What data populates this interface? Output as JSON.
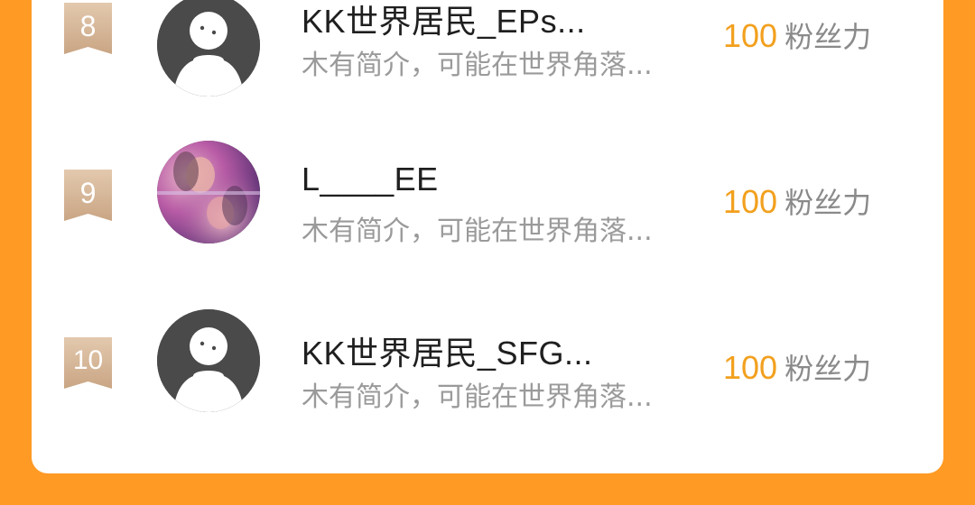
{
  "ranking": {
    "rows": [
      {
        "rank": "8",
        "name": "KK世界居民_EPs...",
        "bio": "木有简介，可能在世界角落...",
        "fans_count": "100",
        "fans_label": "粉丝力",
        "avatar_icon": "default-avatar-icon"
      },
      {
        "rank": "9",
        "name": "L____EE",
        "bio": "木有简介，可能在世界角落...",
        "fans_count": "100",
        "fans_label": "粉丝力",
        "avatar_icon": "photo-avatar"
      },
      {
        "rank": "10",
        "name": "KK世界居民_SFG...",
        "bio": "木有简介，可能在世界角落...",
        "fans_count": "100",
        "fans_label": "粉丝力",
        "avatar_icon": "default-avatar-icon"
      }
    ]
  },
  "colors": {
    "background": "#FF9A24",
    "panel": "#ffffff",
    "fans_count": "#F2A01E",
    "rank_badge": "#D9B89A"
  }
}
